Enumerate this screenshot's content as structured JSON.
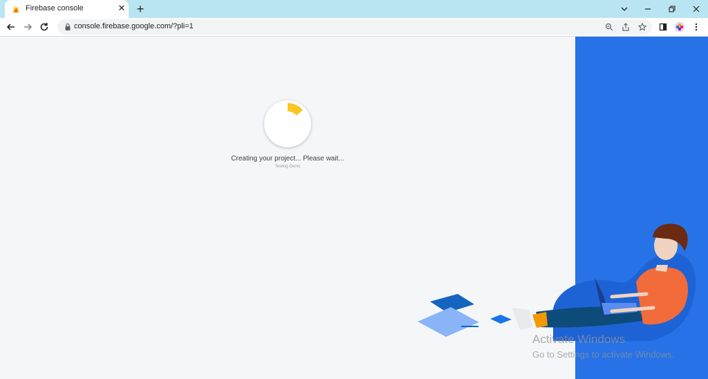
{
  "browser": {
    "tab_title": "Firebase console",
    "tab_close_icon": "close-icon",
    "new_tab_icon": "plus-icon",
    "url": "console.firebase.google.com/?pli=1",
    "window_controls": [
      "chevron-down-icon",
      "minimize-icon",
      "restore-icon",
      "close-icon"
    ]
  },
  "loading": {
    "message": "Creating your project... Please wait...",
    "project_name": "Testing-Demo",
    "spinner_color": "#f9c624"
  },
  "watermark": {
    "title": "Activate Windows",
    "subtitle": "Go to Settings to activate Windows."
  },
  "colors": {
    "tabstrip": "#b9e5f2",
    "panel": "#2672e6",
    "background": "#f5f6f8"
  }
}
